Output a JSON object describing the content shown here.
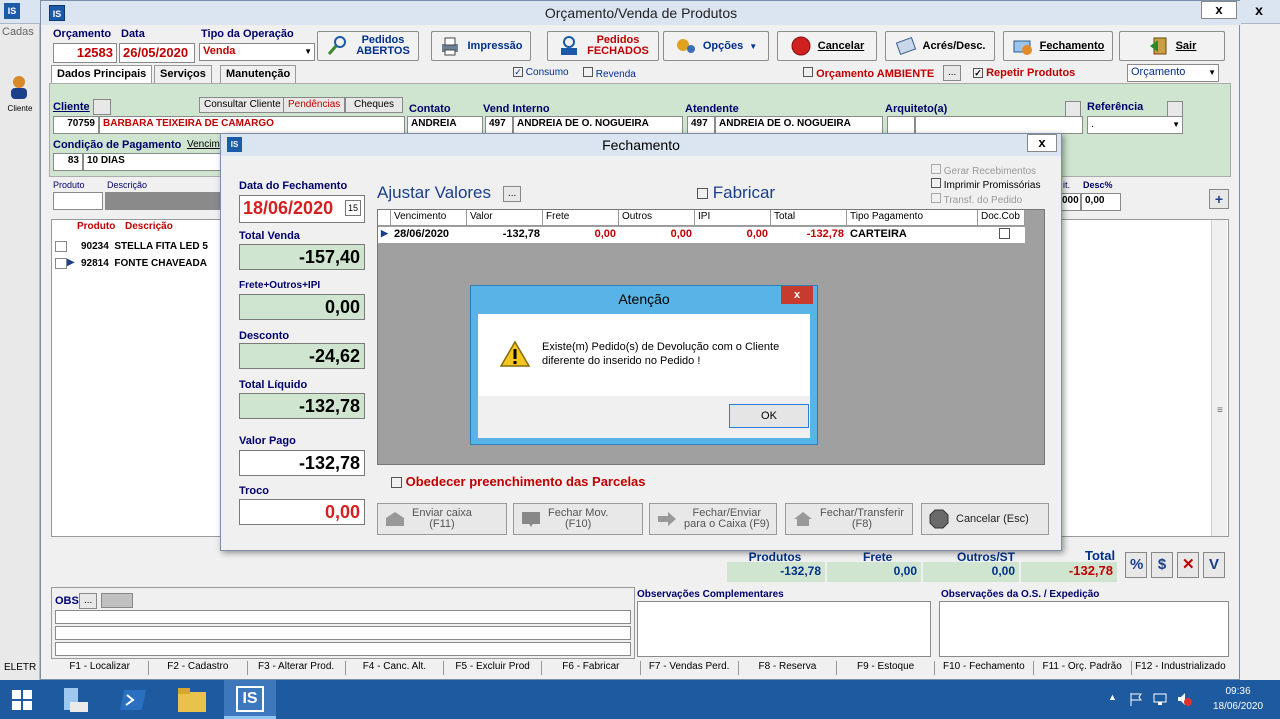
{
  "bg_window": {
    "title_partial": "IS",
    "side_label": "Cadas",
    "side_client": "Cliente",
    "eletr": "ELETR",
    "close": "x"
  },
  "main": {
    "title": "Orçamento/Venda de Produtos",
    "close": "x",
    "logo": "IS",
    "orcamento_label": "Orçamento",
    "orcamento_value": "12583",
    "data_label": "Data",
    "data_value": "26/05/2020",
    "tipo_label": "Tipo da Operação",
    "tipo_value": "Venda",
    "toolbar": {
      "pedidos_abertos": "Pedidos\nABERTOS",
      "impressao": "Impressão",
      "pedidos_fechados": "Pedidos\nFECHADOS",
      "opcoes": "Opções",
      "cancelar": "Cancelar",
      "acres_desc": "Acrés/Desc.",
      "fechamento": "Fechamento",
      "sair": "Sair"
    },
    "tabs": [
      "Dados Principais",
      "Serviços",
      "Manutenção"
    ],
    "consumo": "Consumo",
    "revenda": "Revenda",
    "orcamento_ambiente": "Orçamento AMBIENTE",
    "repetir_produtos": "Repetir Produtos",
    "orcamento_select": "Orçamento",
    "cliente_label": "Cliente",
    "consultar_cliente": "Consultar Cliente",
    "pendencias": "Pendências",
    "cheques": "Cheques",
    "cliente_code": "70759",
    "cliente_name": "BARBARA TEIXEIRA DE CAMARGO",
    "contato_label": "Contato",
    "contato_value": "ANDREIA",
    "vend_label": "Vend Interno",
    "vend_code": "497",
    "vend_name": "ANDREIA DE O. NOGUEIRA",
    "atendente_label": "Atendente",
    "atendente_code": "497",
    "atendente_name": "ANDREIA DE O. NOGUEIRA",
    "arquiteto_label": "Arquiteto(a)",
    "referencia_label": "Referência",
    "referencia_value": ".",
    "cond_label": "Condição de Pagamento",
    "vencim_label": "Vencim",
    "cond_code": "83",
    "cond_name": "10 DIAS",
    "produto_label": "Produto",
    "descricao_label": "Descrição",
    "it_label": "it.",
    "desc_pct_label": "Desc%",
    "desc_val1": "000",
    "desc_val2": "0,00",
    "grid_headers": [
      "Produto",
      "Descrição"
    ],
    "grid_rows": [
      {
        "code": "90234",
        "desc": "STELLA FITA LED 5"
      },
      {
        "code": "92814",
        "desc": "FONTE CHAVEADA"
      }
    ],
    "totals": {
      "produtos_label": "Produtos",
      "produtos_value": "-132,78",
      "frete_label": "Frete",
      "frete_value": "0,00",
      "outros_label": "Outros/ST",
      "outros_value": "0,00",
      "total_label": "Total",
      "total_value": "-132,78"
    },
    "total_btns": [
      "%",
      "$",
      "✕",
      "V"
    ],
    "obs_label": "OBS",
    "obs_btn": "...",
    "obs_comp_label": "Observações Complementares",
    "obs_os_label": "Observações da O.S. / Expedição",
    "fkeys": [
      "F1 - Localizar",
      "F2 - Cadastro",
      "F3 - Alterar Prod.",
      "F4 - Canc. Alt.",
      "F5 - Excluir Prod",
      "F6 - Fabricar",
      "F7 - Vendas Perd.",
      "F8 - Reserva",
      "F9 - Estoque",
      "F10 - Fechamento",
      "F11 - Orç. Padrão",
      "F12 - Industrializado"
    ]
  },
  "fechamento": {
    "title": "Fechamento",
    "close": "x",
    "data_label": "Data do Fechamento",
    "data_value": "18/06/2020",
    "total_venda_label": "Total Venda",
    "total_venda_value": "-157,40",
    "frete_label": "Frete+Outros+IPI",
    "frete_value": "0,00",
    "desconto_label": "Desconto",
    "desconto_value": "-24,62",
    "total_liquido_label": "Total Líquido",
    "total_liquido_value": "-132,78",
    "valor_pago_label": "Valor Pago",
    "valor_pago_value": "-132,78",
    "troco_label": "Troco",
    "troco_value": "0,00",
    "ajustar": "Ajustar Valores",
    "ajustar_btn": "...",
    "fabricar": "Fabricar",
    "gerar": "Gerar Recebimentos",
    "imprimir": "Imprimir Promissórias",
    "transf": "Transf. do Pedido",
    "table_headers": [
      "Vencimento",
      "Valor",
      "Frete",
      "Outros",
      "IPI",
      "Total",
      "Tipo Pagamento",
      "Doc.Cob"
    ],
    "row": {
      "vencimento": "28/06/2020",
      "valor": "-132,78",
      "frete": "0,00",
      "outros": "0,00",
      "ipi": "0,00",
      "total": "-132,78",
      "tipo": "CARTEIRA"
    },
    "obedecer": "Obedecer preenchimento das Parcelas",
    "btn_enviar": "Enviar caixa\n(F11)",
    "btn_fechar_mov": "Fechar Mov.\n(F10)",
    "btn_fechar_enviar": "Fechar/Enviar\npara o Caixa (F9)",
    "btn_fechar_transf": "Fechar/Transferir\n(F8)",
    "btn_cancelar": "Cancelar (Esc)"
  },
  "alert": {
    "title": "Atenção",
    "close": "x",
    "message": "Existe(m) Pedido(s) de Devolução com o Cliente diferente do inserido no Pedido !",
    "ok": "OK"
  },
  "taskbar": {
    "time": "09:36",
    "date": "18/06/2020",
    "app": "IS"
  }
}
